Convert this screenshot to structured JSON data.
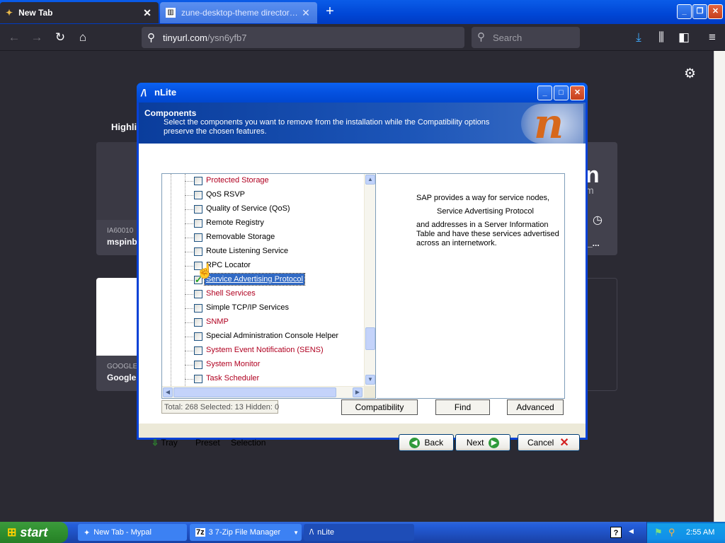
{
  "browser": {
    "tabs": [
      {
        "title": "New Tab",
        "active": true
      },
      {
        "title": "zune-desktop-theme directory listing",
        "active": false
      }
    ],
    "url": {
      "domain": "tinyurl.com",
      "path": "/ysn6yfb7"
    },
    "search_placeholder": "Search"
  },
  "newtab_page": {
    "highlights_label": "Highli",
    "cards": [
      {
        "sub": "IA60010",
        "name": "mspinb"
      },
      {
        "sub": "GOOGLE",
        "name": "Google"
      }
    ],
    "right_fragments": [
      "n",
      "m",
      "_..."
    ]
  },
  "dialog": {
    "title": "nLite",
    "header": {
      "title": "Components",
      "description": "Select the components you want to remove from the installation while the Compatibility options preserve the chosen features."
    },
    "tree_items": [
      {
        "label": "Protected Storage",
        "checked": false,
        "red": true,
        "selected": false
      },
      {
        "label": "QoS RSVP",
        "checked": false,
        "red": false,
        "selected": false
      },
      {
        "label": "Quality of Service (QoS)",
        "checked": false,
        "red": false,
        "selected": false
      },
      {
        "label": "Remote Registry",
        "checked": false,
        "red": false,
        "selected": false
      },
      {
        "label": "Removable Storage",
        "checked": false,
        "red": false,
        "selected": false
      },
      {
        "label": "Route Listening Service",
        "checked": false,
        "red": false,
        "selected": false
      },
      {
        "label": "RPC Locator",
        "checked": false,
        "red": false,
        "selected": false
      },
      {
        "label": "Service Advertising Protocol",
        "checked": true,
        "red": false,
        "selected": true
      },
      {
        "label": "Shell Services",
        "checked": false,
        "red": true,
        "selected": false
      },
      {
        "label": "Simple TCP/IP Services",
        "checked": false,
        "red": false,
        "selected": false
      },
      {
        "label": "SNMP",
        "checked": false,
        "red": true,
        "selected": false
      },
      {
        "label": "Special Administration Console Helper",
        "checked": false,
        "red": false,
        "selected": false
      },
      {
        "label": "System Event Notification (SENS)",
        "checked": false,
        "red": true,
        "selected": false
      },
      {
        "label": "System Monitor",
        "checked": false,
        "red": true,
        "selected": false
      },
      {
        "label": "Task Scheduler",
        "checked": false,
        "red": true,
        "selected": false
      }
    ],
    "description_panel": {
      "line1": "SAP provides a way for service nodes,",
      "line2": "Service Advertising Protocol",
      "line3": "and addresses in a Server Information Table and have these services advertised across an internetwork."
    },
    "status": "Total: 268 Selected: 13 Hidden: 0",
    "buttons": {
      "compatibility": "Compatibility",
      "find": "Find",
      "advanced": "Advanced",
      "back": "Back",
      "next": "Next",
      "cancel": "Cancel"
    },
    "footer_links": {
      "tray": "Tray",
      "preset": "Preset",
      "selection": "Selection"
    }
  },
  "taskbar": {
    "start_label": "start",
    "tasks": [
      {
        "label": "New Tab - Mypal"
      },
      {
        "label": "3 7-Zip File Manager"
      },
      {
        "label": "nLite"
      }
    ],
    "clock": "2:55 AM"
  }
}
